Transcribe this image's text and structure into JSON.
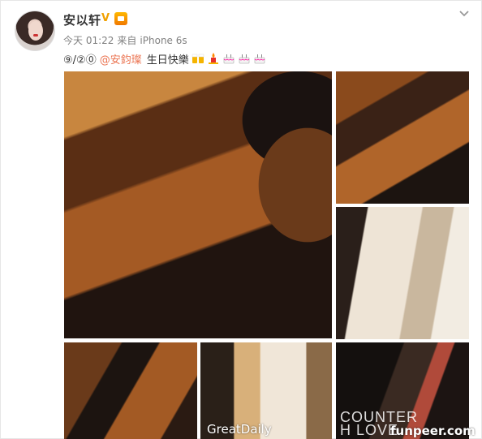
{
  "user": {
    "name": "安以轩",
    "verified_icon": "verified-v-icon",
    "vip_icon": "vip-crown-icon"
  },
  "meta": {
    "time": "今天 01:22",
    "source_prefix": "来自",
    "device": "iPhone 6s"
  },
  "post": {
    "prefix": "⑨/②⓪",
    "mention": "@安鈞璨",
    "text": "生日快樂",
    "emojis": [
      "beer-cheers-icon",
      "candle-icon",
      "cake-icon",
      "cake-icon",
      "cake-icon"
    ]
  },
  "photos": {
    "count": 6,
    "watermark_greatdaily": "GreatDaily",
    "watermark_funpeer": "funpeer.com",
    "magazine_text_line1": "COUNTER",
    "magazine_text_line2": "H LOVE"
  },
  "colors": {
    "mention": "#eb7350",
    "meta": "#808080",
    "verified": "#f0a000"
  }
}
